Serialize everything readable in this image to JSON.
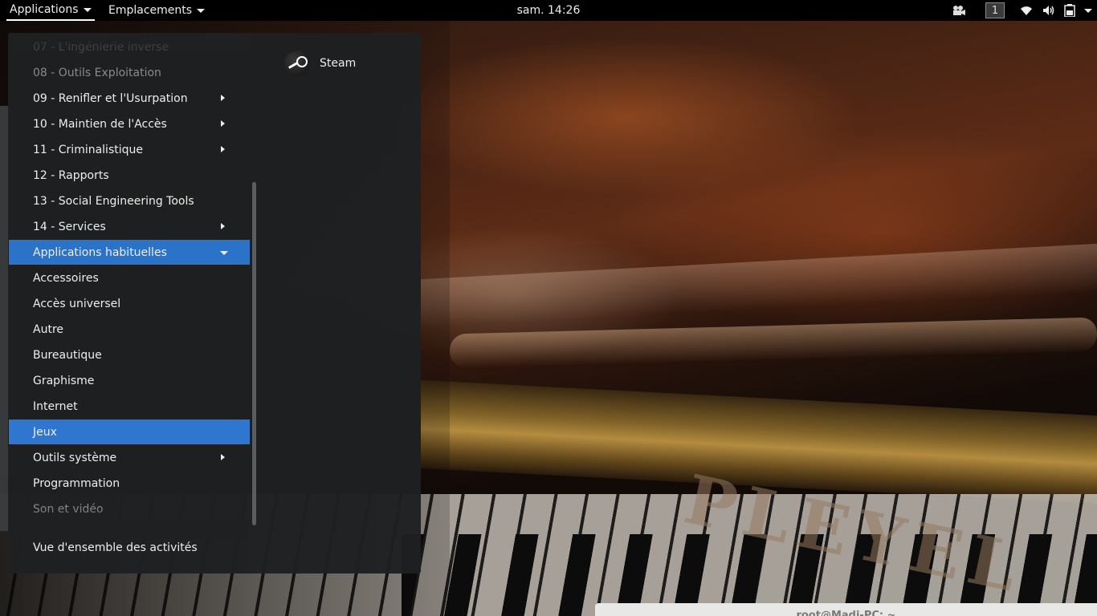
{
  "topbar": {
    "applications_label": "Applications",
    "places_label": "Emplacements",
    "clock": "sam. 14:26",
    "workspace_number": "1",
    "tray_icons": [
      "video-icon",
      "wifi-icon",
      "volume-icon",
      "battery-icon",
      "chevron-down-icon"
    ]
  },
  "menu": {
    "categories": [
      {
        "label": "07 - L'ingénierie inverse",
        "submenu": false,
        "state": "veryfaded"
      },
      {
        "label": "08 - Outils Exploitation",
        "submenu": false,
        "state": "faded"
      },
      {
        "label": "09 - Renifler et l'Usurpation",
        "submenu": true,
        "state": "normal"
      },
      {
        "label": "10 - Maintien de l'Accès",
        "submenu": true,
        "state": "normal"
      },
      {
        "label": "11 - Criminalistique",
        "submenu": true,
        "state": "normal"
      },
      {
        "label": "12 - Rapports",
        "submenu": false,
        "state": "normal"
      },
      {
        "label": "13 - Social Engineering Tools",
        "submenu": false,
        "state": "normal"
      },
      {
        "label": "14 - Services",
        "submenu": true,
        "state": "normal"
      },
      {
        "label": "Applications habituelles",
        "submenu": "expanded",
        "state": "selected"
      },
      {
        "label": "Accessoires",
        "submenu": false,
        "state": "normal"
      },
      {
        "label": "Accès universel",
        "submenu": false,
        "state": "normal"
      },
      {
        "label": "Autre",
        "submenu": false,
        "state": "normal"
      },
      {
        "label": "Bureautique",
        "submenu": false,
        "state": "normal"
      },
      {
        "label": "Graphisme",
        "submenu": false,
        "state": "normal"
      },
      {
        "label": "Internet",
        "submenu": false,
        "state": "normal"
      },
      {
        "label": "Jeux",
        "submenu": false,
        "state": "hover"
      },
      {
        "label": "Outils système",
        "submenu": true,
        "state": "normal"
      },
      {
        "label": "Programmation",
        "submenu": false,
        "state": "normal"
      },
      {
        "label": "Son et vidéo",
        "submenu": false,
        "state": "faded"
      }
    ],
    "activities_label": "Vue d'ensemble des activités",
    "apps": [
      {
        "label": "Steam",
        "icon": "steam-icon"
      }
    ]
  },
  "terminal": {
    "title": "root@Madi-PC: ~"
  },
  "wallpaper": {
    "brand_text": "PLEYEL"
  },
  "colors": {
    "selection": "#2b72c9",
    "menu_bg": "#1e2022",
    "topbar_bg": "#000000"
  }
}
